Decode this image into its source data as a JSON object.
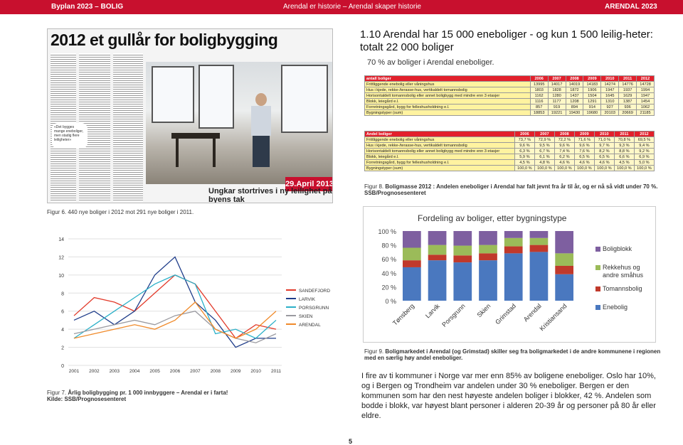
{
  "header": {
    "left": "Byplan 2023 – BOLIG",
    "middle": "Arendal er historie – Arendal skaper historie",
    "right": "ARENDAL 2023"
  },
  "clipping": {
    "headline": "2012 et gullår for boligbygging",
    "pull_quote": "«Det bygges mange eneboliger, men stadig flere leiligheter»",
    "date_badge": "29.April 2013",
    "subheadline": "Ungkar stortrives i ny leilighet på byens tak"
  },
  "section": {
    "title": "1.10  Arendal har 15 000 eneboliger  - og kun 1 500 leilig-heter: totalt 22 000 boliger",
    "subtitle": "70 % av boliger i Arendal eneboliger."
  },
  "table1": {
    "header": [
      "antall boliger",
      "2006",
      "2007",
      "2008",
      "2009",
      "2010",
      "2011",
      "2012"
    ],
    "rows": [
      [
        "Frittliggende enebolig eller våningshus",
        "13995",
        "14017",
        "14019",
        "14183",
        "14274",
        "14776",
        "14728"
      ],
      [
        "Hus i kjede, rekke-/terasse-hus, vertikaldelt tomannsbolig",
        "1803",
        "1828",
        "1872",
        "1906",
        "1947",
        "1937",
        "1994"
      ],
      [
        "Horisontaldelt tomannsbolig eller annet boligbygg med mindre enn 3 etasjer",
        "1162",
        "1280",
        "1437",
        "1504",
        "1645",
        "1629",
        "1947"
      ],
      [
        "Blokk, leiegård e.l.",
        "1116",
        "1177",
        "1208",
        "1291",
        "1310",
        "1387",
        "1454"
      ],
      [
        "Forretningsgård, bygg for felleshusholdning e.l.",
        "857",
        "919",
        "894",
        "914",
        "927",
        "936",
        "1062"
      ],
      [
        "Bygningstyper (sum)",
        "18853",
        "19221",
        "19430",
        "19680",
        "20103",
        "20669",
        "21185"
      ]
    ]
  },
  "table2": {
    "header": [
      "Andel boliger",
      "2006",
      "2007",
      "2008",
      "2009",
      "2010",
      "2011",
      "2012"
    ],
    "rows": [
      [
        "Frittliggende enebolig eller våningshus",
        "73,7 %",
        "72,9 %",
        "72,2 %",
        "71,6 %",
        "71,0 %",
        "70,8 %",
        "69,5 %"
      ],
      [
        "Hus i kjede, rekke-/terasse-hus, vertikaldelt tomannsbolig",
        "9,6 %",
        "9,5 %",
        "9,6 %",
        "9,6 %",
        "9,7 %",
        "9,3 %",
        "9,4 %"
      ],
      [
        "Horisontaldelt tomannsbolig eller annet boligbygg med mindre enn 3 etasjer",
        "6,3 %",
        "6,7 %",
        "7,4 %",
        "7,6 %",
        "8,2 %",
        "8,8 %",
        "9,2 %"
      ],
      [
        "Blokk, leiegård e.l.",
        "5,9 %",
        "6,1 %",
        "6,2 %",
        "6,5 %",
        "6,5 %",
        "6,6 %",
        "6,9 %"
      ],
      [
        "Forretningsgård, bygg for felleshusholdning e.l.",
        "4,5 %",
        "4,8 %",
        "4,6 %",
        "4,6 %",
        "4,6 %",
        "4,5 %",
        "5,0 %"
      ],
      [
        "Bygningstyper (sum)",
        "100,0 %",
        "100,0 %",
        "100,0 %",
        "100,0 %",
        "100,0 %",
        "100,0 %",
        "100,0 %"
      ]
    ]
  },
  "captions": {
    "fig8_label": "Figur 8.",
    "fig8_text": "Boligmasse 2012 : Andelen eneboliger i Arendal har falt jevnt fra år til år, og er nå så vidt under 70 %. SSB/Prognosesenteret",
    "fig6": "Figur 6.   440 nye boliger i 2012 mot 291 nye boliger i 2011.",
    "fig7_label": "Figur 7.",
    "fig7_text": "Årlig boligbygging pr. 1 000 innbyggere – Arendal er i farta!",
    "fig7_source": "Kilde: SSB/Prognosesenteret",
    "fig9_label": "Figur 9.",
    "fig9_text": "Boligmarkedet i Arendal (og Grimstad) skiller seg fra boligmarkedet i de andre kommunene i regionen med en særlig høy andel eneboliger."
  },
  "body_text": "I fire av ti kommuner i Norge var mer enn 85% av boligene eneboliger. Oslo har 10%, og i Bergen og Trondheim var andelen under 30 % eneboliger. Bergen er den kommunen som har den nest høyeste andelen boliger i blokker, 42 %. Andelen som bodde i blokk, var høyest blant personer i alderen 20-39 år og personer på 80 år eller eldre.",
  "page_number": "5",
  "chart_data": [
    {
      "type": "line",
      "title": "",
      "x": [
        2001,
        2002,
        2003,
        2004,
        2005,
        2006,
        2007,
        2008,
        2009,
        2010,
        2011
      ],
      "ylim": [
        0,
        14
      ],
      "yticks": [
        0,
        2,
        4,
        6,
        8,
        10,
        12,
        14
      ],
      "series": [
        {
          "name": "SANDEFJORD",
          "color": "#e23a2a",
          "values": [
            5.5,
            7.5,
            7.0,
            6.0,
            8.0,
            10.0,
            9.0,
            6.0,
            3.0,
            4.5,
            4.0
          ]
        },
        {
          "name": "LARVIK",
          "color": "#1f3d8a",
          "values": [
            5.0,
            6.0,
            4.5,
            6.0,
            10.0,
            12.0,
            7.0,
            5.0,
            2.0,
            3.0,
            3.0
          ]
        },
        {
          "name": "PORSGRUNN",
          "color": "#2bb0c8",
          "values": [
            3.0,
            4.5,
            6.0,
            7.5,
            9.0,
            10.0,
            9.0,
            3.5,
            4.0,
            3.0,
            5.0
          ]
        },
        {
          "name": "SKIEN",
          "color": "#9a9aa0",
          "values": [
            3.5,
            4.0,
            4.5,
            5.0,
            4.5,
            5.5,
            6.0,
            4.0,
            3.0,
            2.5,
            3.5
          ]
        },
        {
          "name": "ARENDAL",
          "color": "#f08a2a",
          "values": [
            3.0,
            3.5,
            4.0,
            4.5,
            4.0,
            5.0,
            7.0,
            4.0,
            3.0,
            4.0,
            6.0
          ]
        }
      ]
    },
    {
      "type": "bar",
      "title": "Fordeling av boliger, etter bygningstype",
      "categories": [
        "Tønsberg",
        "Larvik",
        "Porsgrunn",
        "Skien",
        "Grimstad",
        "Arendal",
        "Kristiansand"
      ],
      "ylim": [
        0,
        100
      ],
      "yticks": [
        "0 %",
        "20 %",
        "40 %",
        "60 %",
        "80 %",
        "100 %"
      ],
      "stacked": true,
      "series": [
        {
          "name": "Enebolig",
          "color": "#4a78bf",
          "values": [
            48,
            58,
            55,
            58,
            68,
            70,
            38
          ]
        },
        {
          "name": "Tomannsbolig",
          "color": "#c0392b",
          "values": [
            10,
            8,
            10,
            10,
            10,
            10,
            12
          ]
        },
        {
          "name": "Rekkehus og andre småhus",
          "color": "#9bbb59",
          "values": [
            18,
            14,
            14,
            12,
            12,
            10,
            18
          ]
        },
        {
          "name": "Boligblokk",
          "color": "#7e5fa0",
          "values": [
            24,
            20,
            21,
            20,
            10,
            10,
            32
          ]
        }
      ],
      "legend": [
        "Boligblokk",
        "Rekkehus og andre småhus",
        "Tomannsbolig",
        "Enebolig"
      ]
    }
  ]
}
